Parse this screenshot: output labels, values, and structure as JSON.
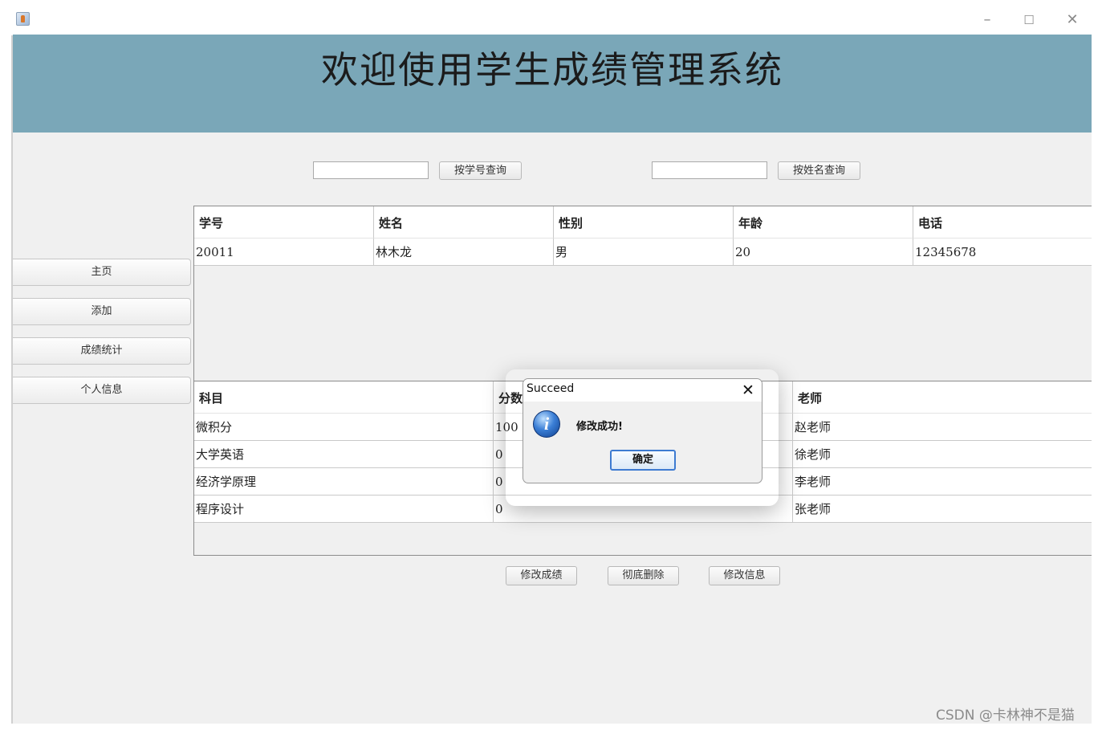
{
  "window": {
    "minimize_glyph": "–",
    "maximize_glyph": "☐",
    "close_glyph": "✕",
    "banner_title": "欢迎使用学生成绩管理系统"
  },
  "search": {
    "by_id_button": "按学号查询",
    "by_name_button": "按姓名查询",
    "id_value": "",
    "name_value": ""
  },
  "sidebar": {
    "items": [
      {
        "label": "主页"
      },
      {
        "label": "添加"
      },
      {
        "label": "成绩统计"
      },
      {
        "label": "个人信息"
      }
    ]
  },
  "student_table": {
    "headers": [
      "学号",
      "姓名",
      "性别",
      "年龄",
      "电话"
    ],
    "rows": [
      [
        "20011",
        "林木龙",
        "男",
        "20",
        "12345678"
      ]
    ]
  },
  "score_table": {
    "headers": [
      "科目",
      "分数",
      "",
      "老师"
    ],
    "rows": [
      [
        "微积分",
        "100",
        "",
        "赵老师"
      ],
      [
        "大学英语",
        "0",
        "",
        "徐老师"
      ],
      [
        "经济学原理",
        "0",
        "",
        "李老师"
      ],
      [
        "程序设计",
        "0",
        "",
        "张老师"
      ]
    ]
  },
  "actions": {
    "edit_score": "修改成绩",
    "delete_all": "彻底删除",
    "edit_info": "修改信息"
  },
  "dialog": {
    "title": "Succeed",
    "message": "修改成功!",
    "ok_label": "确定",
    "close_glyph": "✕",
    "icon_glyph": "i"
  },
  "watermark": "CSDN @卡林神不是猫",
  "colors": {
    "banner": "#7aa7b8",
    "background": "#f0f0f0",
    "dialog_button_border": "#3d7bd1"
  }
}
